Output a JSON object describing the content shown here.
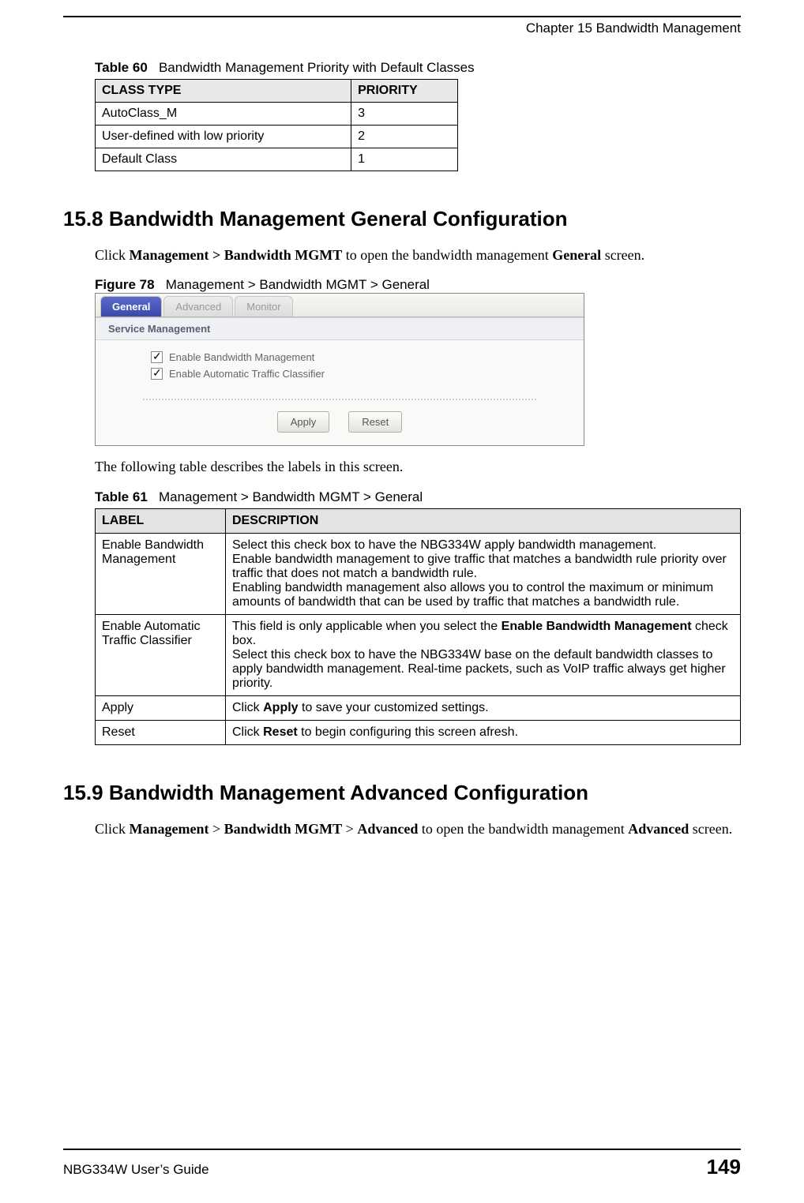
{
  "header": {
    "chapter": "Chapter 15 Bandwidth Management"
  },
  "table60": {
    "caption_prefix": "Table 60",
    "caption": "Bandwidth Management Priority with Default Classes",
    "headers": [
      "CLASS TYPE",
      "PRIORITY"
    ],
    "rows": [
      [
        "AutoClass_M",
        "3"
      ],
      [
        "User-defined with low priority",
        "2"
      ],
      [
        "Default Class",
        "1"
      ]
    ]
  },
  "section_15_8": {
    "heading": "15.8  Bandwidth Management General Configuration",
    "body_prefix": "Click ",
    "body_bold1": "Management > Bandwidth MGMT",
    "body_mid": " to open the bandwidth management ",
    "body_bold2": "General",
    "body_suffix": " screen."
  },
  "figure78": {
    "caption_prefix": "Figure 78",
    "caption": "Management > Bandwidth MGMT > General",
    "tabs": [
      "General",
      "Advanced",
      "Monitor"
    ],
    "section_label": "Service Management",
    "checkbox1": "Enable Bandwidth Management",
    "checkbox2": "Enable Automatic Traffic Classifier",
    "apply": "Apply",
    "reset": "Reset"
  },
  "table61_intro": "The following table describes the labels in this screen.",
  "table61": {
    "caption_prefix": "Table 61",
    "caption": "Management > Bandwidth MGMT > General",
    "headers": [
      "LABEL",
      "DESCRIPTION"
    ],
    "rows": [
      {
        "label": "Enable Bandwidth Management",
        "desc": "Select this check box to have the NBG334W apply bandwidth management.\nEnable bandwidth management to give traffic that matches a bandwidth rule priority over traffic that does not match a bandwidth rule.\nEnabling bandwidth management also allows you to control the maximum or minimum amounts of bandwidth that can be used by traffic that matches a bandwidth rule."
      },
      {
        "label": "Enable Automatic Traffic Classifier",
        "desc_pre": "This field is only applicable when you select the ",
        "desc_bold": "Enable Bandwidth Management",
        "desc_post": " check box.\nSelect this check box to have the NBG334W base on the default bandwidth classes to apply bandwidth management. Real-time packets, such as VoIP traffic always get higher priority."
      },
      {
        "label": "Apply",
        "desc_pre": "Click ",
        "desc_bold": "Apply",
        "desc_post": " to save your customized settings."
      },
      {
        "label": "Reset",
        "desc_pre": "Click ",
        "desc_bold": "Reset",
        "desc_post": " to begin configuring this screen afresh."
      }
    ]
  },
  "section_15_9": {
    "heading": "15.9  Bandwidth Management Advanced Configuration",
    "body_prefix": "Click ",
    "body_bold1": "Management",
    "body_sep1": " > ",
    "body_bold2": "Bandwidth MGMT",
    "body_sep2": " > ",
    "body_bold3": "Advanced",
    "body_mid": " to open the bandwidth management ",
    "body_bold4": "Advanced",
    "body_suffix": " screen."
  },
  "footer": {
    "guide": "NBG334W User’s Guide",
    "page": "149"
  }
}
